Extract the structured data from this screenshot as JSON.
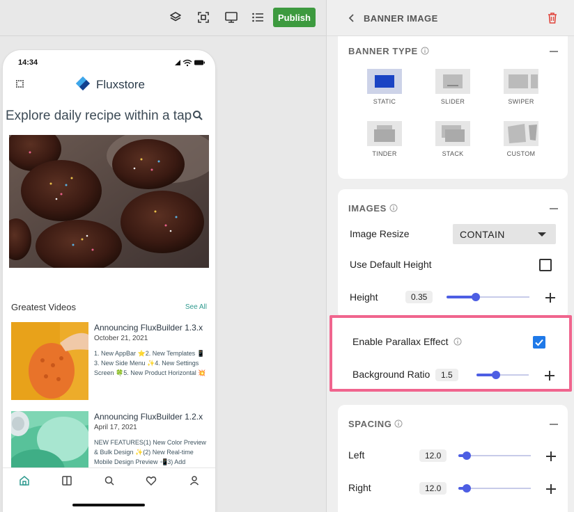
{
  "toolbar": {
    "publish_label": "Publish",
    "icons": [
      "layers-icon",
      "scan-icon",
      "monitor-icon",
      "list-icon"
    ]
  },
  "phone": {
    "status_time": "14:34",
    "brand_name": "Fluxstore",
    "headline": "Explore daily recipe within a tap",
    "section_title": "Greatest Videos",
    "see_all": "See All",
    "videos": [
      {
        "title": "Announcing FluxBuilder 1.3.x",
        "date": "October 21, 2021",
        "description": "1. New AppBar ⭐2. New Templates 📱 3. New Side Menu ✨4. New Settings Screen 🍀5. New Product Horizontal 💥"
      },
      {
        "title": "Announcing FluxBuilder 1.2.x",
        "date": "April 17, 2021",
        "description": "NEW FEATURES(1) New Color Preview & Bulk Design ✨(2) New Real-time Mobile Design Preview 📲3) Add"
      }
    ],
    "nav": [
      "home-icon",
      "book-icon",
      "search-icon",
      "heart-icon",
      "user-icon"
    ]
  },
  "panel": {
    "title": "BANNER IMAGE",
    "banner_type": {
      "title": "BANNER TYPE",
      "options": [
        "STATIC",
        "SLIDER",
        "SWIPER",
        "TINDER",
        "STACK",
        "CUSTOM"
      ],
      "selected": "STATIC"
    },
    "images": {
      "title": "IMAGES",
      "resize_label": "Image Resize",
      "resize_value": "CONTAIN",
      "default_height_label": "Use Default Height",
      "default_height_checked": false,
      "height_label": "Height",
      "height_value": "0.35",
      "height_fraction": 0.35
    },
    "parallax": {
      "enable_label": "Enable Parallax Effect",
      "enabled": true,
      "ratio_label": "Background Ratio",
      "ratio_value": "1.5",
      "ratio_fraction": 0.37
    },
    "spacing": {
      "title": "SPACING",
      "left_label": "Left",
      "left_value": "12.0",
      "left_fraction": 0.12,
      "right_label": "Right",
      "right_value": "12.0",
      "right_fraction": 0.12
    }
  },
  "colors": {
    "publish": "#3d9a3f",
    "accent": "#4d5ee3",
    "highlight": "#f0658e",
    "checkbox": "#1f79e8",
    "delete": "#e0473e",
    "link": "#2f9a8f"
  }
}
